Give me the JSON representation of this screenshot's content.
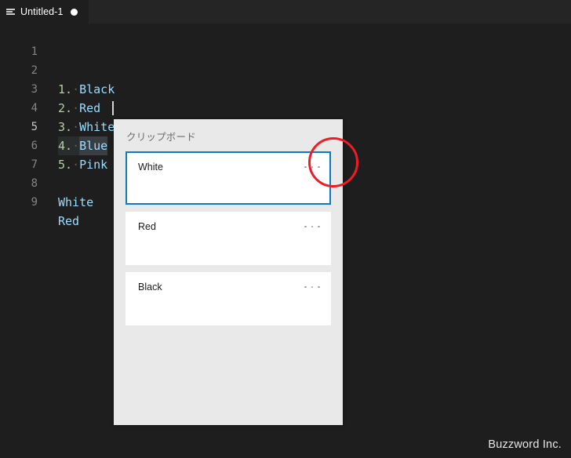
{
  "window": {
    "background_color": "#1e1e1e",
    "tab_bar_color": "#252526"
  },
  "tab_bar": {
    "tabs": [
      {
        "label": "Untitled-1",
        "icon": "document-lines-icon",
        "dirty": true,
        "dirty_indicator": "●",
        "active": true
      }
    ]
  },
  "editor": {
    "language_font": "monospace",
    "active_line": 5,
    "cursor_line": 5,
    "cursor_column": 8,
    "selection_text": "Blue",
    "lines": [
      {
        "number": "1",
        "prefix": "",
        "text": ""
      },
      {
        "number": "2",
        "prefix": "1.",
        "text": "Black"
      },
      {
        "number": "3",
        "prefix": "2.",
        "text": "Red"
      },
      {
        "number": "4",
        "prefix": "3.",
        "text": "White"
      },
      {
        "number": "5",
        "prefix": "4.",
        "text": "Blue"
      },
      {
        "number": "6",
        "prefix": "5.",
        "text": "Pink"
      },
      {
        "number": "7",
        "prefix": "",
        "text": ""
      },
      {
        "number": "8",
        "prefix": "",
        "text": "White"
      },
      {
        "number": "9",
        "prefix": "",
        "text": "Red"
      }
    ]
  },
  "clipboard_panel": {
    "title": "クリップボード",
    "background_color": "#e9e9e9",
    "selection_color": "#0d7ac4",
    "items": [
      {
        "text": "White",
        "selected": true,
        "more_label": "…"
      },
      {
        "text": "Red",
        "selected": false,
        "more_label": "…"
      },
      {
        "text": "Black",
        "selected": false,
        "more_label": "…"
      }
    ]
  },
  "annotation": {
    "shape": "circle",
    "color": "#ee1c25",
    "target": "more-options-button-of-first-clipboard-item"
  },
  "watermark": {
    "text": "Buzzword Inc."
  }
}
